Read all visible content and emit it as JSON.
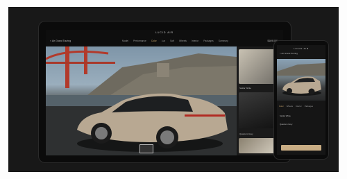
{
  "brand": "LUCID AIR",
  "back_label": "< Air Grand Touring",
  "tabs": [
    {
      "label": "Model",
      "active": false
    },
    {
      "label": "Performance",
      "active": false
    },
    {
      "label": "Color",
      "active": true
    },
    {
      "label": "Lux",
      "active": false
    },
    {
      "label": "Soft",
      "active": false
    },
    {
      "label": "Wheels",
      "active": false
    },
    {
      "label": "Interior",
      "active": false
    },
    {
      "label": "Packages",
      "active": false
    },
    {
      "label": "Summary",
      "active": false
    }
  ],
  "price": "$169,000",
  "panel": {
    "item1": "Stellar White",
    "item2": "Quantum Grey"
  },
  "phone": {
    "brand": "LUCID AIR",
    "back_label": "< Air Grand Touring",
    "tabs": [
      {
        "label": "Color",
        "active": true
      },
      {
        "label": "Wheels",
        "active": false
      },
      {
        "label": "Interior",
        "active": false
      },
      {
        "label": "Packages",
        "active": false
      }
    ],
    "item1": "Stellar White",
    "item2": "Quantum Grey"
  },
  "colors": {
    "accent": "#c9a56b",
    "button": "#c9ad84",
    "frame_bg": "#181818",
    "car_body": "#b8a892"
  },
  "icons": [
    "back-chevron-icon",
    "close-icon",
    "menu-icon"
  ]
}
